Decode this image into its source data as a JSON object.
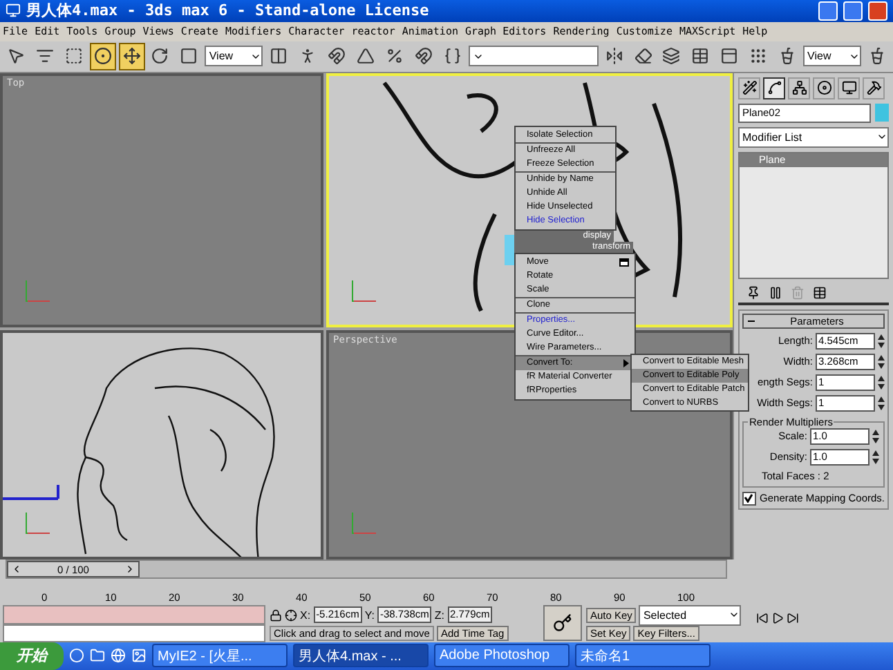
{
  "window": {
    "title": "男人体4.max - 3ds max 6 - Stand-alone License"
  },
  "menu": [
    "File",
    "Edit",
    "Tools",
    "Group",
    "Views",
    "Create",
    "Modifiers",
    "Character",
    "reactor",
    "Animation",
    "Graph Editors",
    "Rendering",
    "Customize",
    "MAXScript",
    "Help"
  ],
  "toolbar": [
    {
      "kind": "select",
      "selected": false
    },
    {
      "kind": "selectname",
      "selected": false
    },
    {
      "kind": "region",
      "selected": false
    },
    {
      "kind": "crossing",
      "selected": true
    },
    {
      "kind": "move",
      "selected": true
    },
    {
      "kind": "rotate",
      "selected": false
    },
    {
      "kind": "scale",
      "selected": false
    },
    {
      "kind": "dropdown",
      "value": "View"
    },
    {
      "kind": "pivot",
      "selected": false
    },
    {
      "kind": "bind",
      "selected": false
    },
    {
      "kind": "snap",
      "selected": false
    },
    {
      "kind": "angle",
      "selected": false
    },
    {
      "kind": "percent",
      "selected": false
    },
    {
      "kind": "spinner",
      "selected": false
    },
    {
      "kind": "named",
      "selected": false
    },
    {
      "kind": "dropdown"
    },
    {
      "kind": "mirror",
      "selected": false
    },
    {
      "kind": "align",
      "selected": false
    },
    {
      "kind": "layers",
      "selected": false
    },
    {
      "kind": "curves",
      "selected": false
    },
    {
      "kind": "schematic",
      "selected": false
    },
    {
      "kind": "material",
      "selected": false
    },
    {
      "kind": "render",
      "selected": false
    },
    {
      "kind": "dropdown",
      "value": "View"
    },
    {
      "kind": "teapot",
      "selected": false
    }
  ],
  "viewports": [
    {
      "label": "Top",
      "active": false,
      "kind": "empty"
    },
    {
      "active": true,
      "kind": "front"
    },
    {
      "active": false,
      "kind": "side"
    },
    {
      "label": "Perspective",
      "active": false,
      "kind": "empty"
    }
  ],
  "quad_menu": {
    "sections": [
      {
        "header": "display",
        "items": [
          {
            "label": "Isolate Selection",
            "recent": false,
            "highlighted": false,
            "separator_before": false,
            "submenu": false,
            "options": false
          },
          {
            "label": "Unfreeze All",
            "recent": false,
            "highlighted": false,
            "separator_before": true,
            "submenu": false,
            "options": false
          },
          {
            "label": "Freeze Selection",
            "recent": false,
            "highlighted": false,
            "separator_before": false,
            "submenu": false,
            "options": false
          },
          {
            "label": "Unhide by Name",
            "recent": false,
            "highlighted": false,
            "separator_before": true,
            "submenu": false,
            "options": false
          },
          {
            "label": "Unhide All",
            "recent": false,
            "highlighted": false,
            "separator_before": false,
            "submenu": false,
            "options": false
          },
          {
            "label": "Hide Unselected",
            "recent": false,
            "highlighted": false,
            "separator_before": false,
            "submenu": false,
            "options": false
          },
          {
            "label": "Hide Selection",
            "recent": true,
            "highlighted": false,
            "separator_before": false,
            "submenu": false,
            "options": false
          }
        ]
      },
      {
        "header": "transform",
        "items": [
          {
            "label": "Move",
            "recent": false,
            "highlighted": false,
            "separator_before": false,
            "submenu": false,
            "options": true
          },
          {
            "label": "Rotate",
            "recent": false,
            "highlighted": false,
            "separator_before": false,
            "submenu": false,
            "options": false
          },
          {
            "label": "Scale",
            "recent": false,
            "highlighted": false,
            "separator_before": false,
            "submenu": false,
            "options": false
          },
          {
            "label": "Clone",
            "recent": false,
            "highlighted": false,
            "separator_before": true,
            "submenu": false,
            "options": false
          },
          {
            "label": "Properties...",
            "recent": true,
            "highlighted": false,
            "separator_before": true,
            "submenu": false,
            "options": false
          },
          {
            "label": "Curve Editor...",
            "recent": false,
            "highlighted": false,
            "separator_before": false,
            "submenu": false,
            "options": false
          },
          {
            "label": "Wire Parameters...",
            "recent": false,
            "highlighted": false,
            "separator_before": false,
            "submenu": false,
            "options": false
          },
          {
            "label": "Convert To:",
            "recent": false,
            "highlighted": true,
            "separator_before": true,
            "submenu": true,
            "options": false
          },
          {
            "label": "fR Material Converter",
            "recent": false,
            "highlighted": false,
            "separator_before": false,
            "submenu": false,
            "options": false
          },
          {
            "label": "fRProperties",
            "recent": false,
            "highlighted": false,
            "separator_before": false,
            "submenu": false,
            "options": false
          }
        ]
      }
    ],
    "submenu": [
      {
        "label": "Convert to Editable Mesh",
        "highlighted": false
      },
      {
        "label": "Convert to Editable Poly",
        "highlighted": true
      },
      {
        "label": "Convert to Editable Patch",
        "highlighted": false
      },
      {
        "label": "Convert to NURBS",
        "highlighted": false
      }
    ]
  },
  "command_panel": {
    "tabs": [
      {
        "kind": "create",
        "selected": false
      },
      {
        "kind": "modify",
        "selected": true
      },
      {
        "kind": "hierarchy",
        "selected": false
      },
      {
        "kind": "motion",
        "selected": false
      },
      {
        "kind": "display",
        "selected": false
      },
      {
        "kind": "utilities",
        "selected": false
      }
    ],
    "object_name": "Plane02",
    "modifier_list": "Modifier List",
    "stack": [
      {
        "label": "Plane",
        "selected": true
      }
    ],
    "rollout": {
      "title": "Parameters",
      "expanded": true,
      "fields": [
        {
          "label": "Length:",
          "value": "4.545cm"
        },
        {
          "label": "Width:",
          "value": "3.268cm"
        },
        {
          "label": "ength Segs:",
          "value": "1"
        },
        {
          "label": "Width Segs:",
          "value": "1"
        }
      ],
      "group": {
        "title": "Render Multipliers",
        "fields": [
          {
            "label": "Scale:",
            "value": "1.0"
          },
          {
            "label": "Density:",
            "value": "1.0"
          }
        ],
        "info": "Total Faces : 2"
      },
      "checkbox": {
        "label": "Generate Mapping Coords.",
        "checked": true
      }
    }
  },
  "timeline": {
    "slider": "0 / 100",
    "level": 0,
    "ticks": [
      "0",
      "10",
      "20",
      "30",
      "40",
      "50",
      "60",
      "70",
      "80",
      "90",
      "100"
    ]
  },
  "status": {
    "coords": [
      {
        "axis": "X:",
        "value": "-5.216cm"
      },
      {
        "axis": "Y:",
        "value": "-38.738cm"
      },
      {
        "axis": "Z:",
        "value": "2.779cm"
      }
    ],
    "prompt": "Click and drag to select and move",
    "time_tag": "Add Time Tag",
    "auto_key": "Auto Key",
    "set_key": "Set Key",
    "key_mode": "Selected",
    "key_filters": "Key Filters..."
  },
  "taskbar": {
    "start": "开始",
    "tasks": [
      {
        "label": "MyIE2 - [火星...",
        "selected": false
      },
      {
        "label": "男人体4.max - ...",
        "selected": true
      },
      {
        "label": "Adobe Photoshop",
        "selected": false
      },
      {
        "label": "未命名1",
        "selected": false
      }
    ]
  }
}
